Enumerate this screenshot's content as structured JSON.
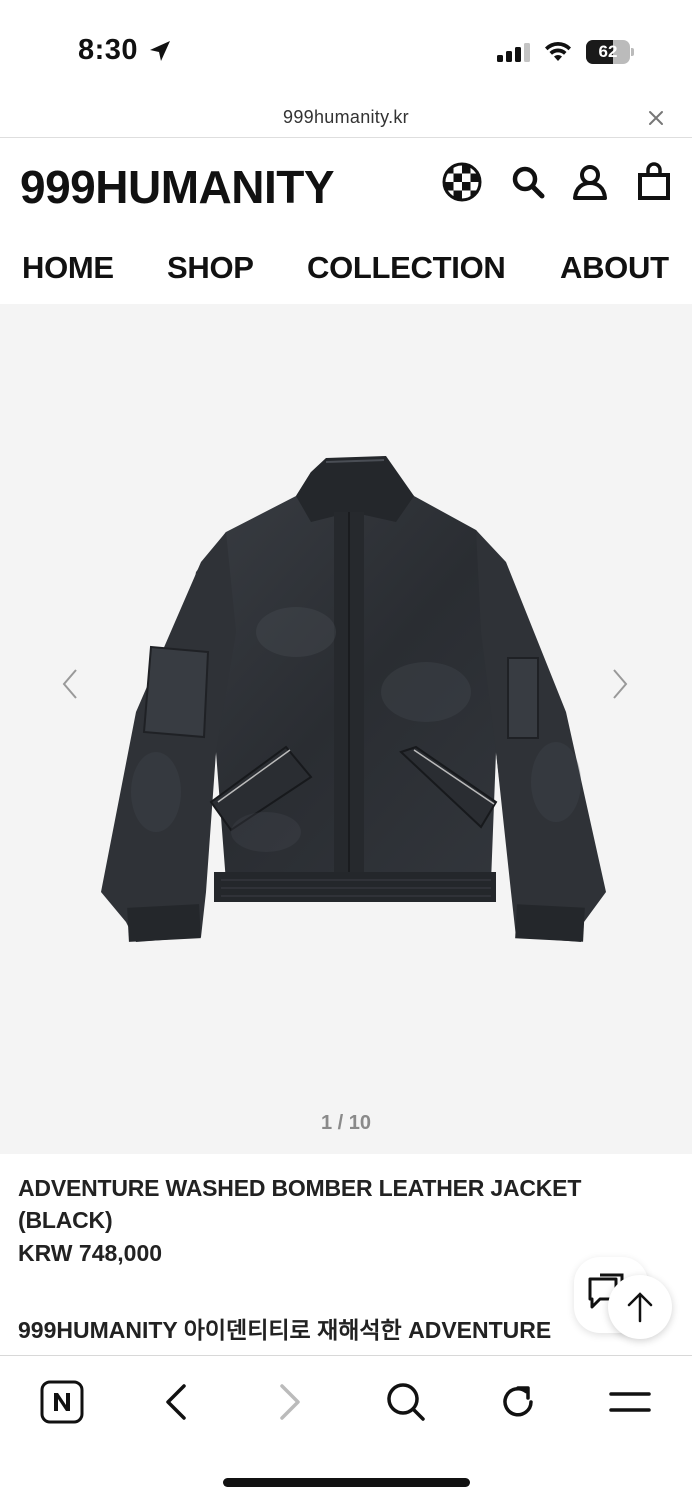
{
  "status_bar": {
    "time": "8:30",
    "battery_percent": 62,
    "battery_label": "62",
    "icons": [
      "location-arrow-icon",
      "cellular-signal-icon",
      "wifi-icon",
      "battery-icon"
    ]
  },
  "browser": {
    "url": "999humanity.kr",
    "close_icon": "close-icon"
  },
  "site": {
    "logo": "999HUMANITY",
    "header_icons": [
      "globe-checker-icon",
      "search-icon",
      "account-icon",
      "cart-icon"
    ],
    "nav": [
      "HOME",
      "SHOP",
      "COLLECTION",
      "ABOUT"
    ]
  },
  "gallery": {
    "counter": "1 / 10",
    "current": 1,
    "total": 10,
    "prev_icon": "chevron-left-icon",
    "next_icon": "chevron-right-icon",
    "image_alt": "black washed leather bomber jacket"
  },
  "product": {
    "name": "ADVENTURE WASHED BOMBER LEATHER JACKET (BLACK)",
    "price": "KRW 748,000",
    "description_line": "999HUMANITY 아이덴티티로 재해석한 ADVENTURE"
  },
  "floating_buttons": {
    "chat_icon": "chat-bubble-icon",
    "top_icon": "arrow-up-icon"
  },
  "toolbar": {
    "icons": [
      "naver-logo-icon",
      "back-icon",
      "forward-icon",
      "search-icon",
      "reload-icon",
      "menu-icon"
    ]
  },
  "colors": {
    "background": "#ffffff",
    "gallery_bg": "#f4f4f4",
    "text": "#222222",
    "muted": "#8a8a8a"
  }
}
